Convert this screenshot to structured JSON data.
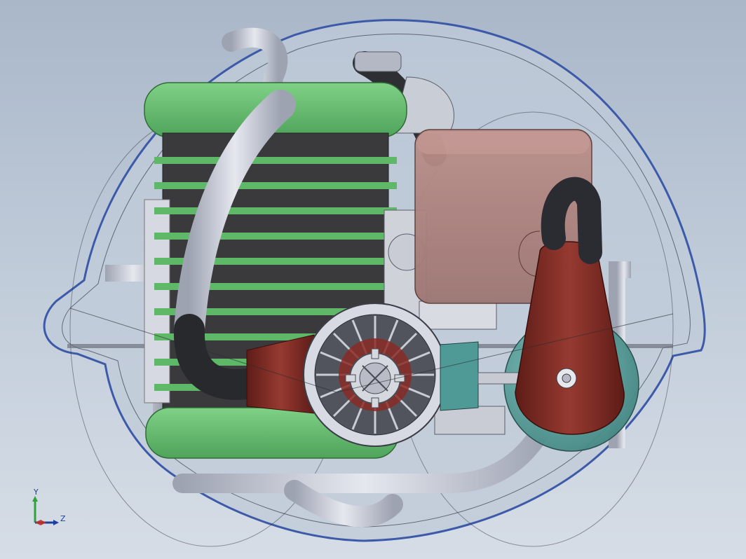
{
  "viewport": {
    "background_top": "#a9b7c9",
    "background_bottom": "#d6dde6"
  },
  "model_colors": {
    "housing_outline": "#3d5aa8",
    "radiator": "#62b86b",
    "radiator_core": "#3a3a3c",
    "tank": "#a57b76",
    "duct": "#8a2f28",
    "tube": "#c6cad6",
    "pump": "#4f9a96"
  },
  "triad": {
    "y_label": "Y",
    "z_label": "Z",
    "x_color": "#c0302a",
    "y_color": "#2fa33a",
    "z_color": "#1d3f9e"
  }
}
